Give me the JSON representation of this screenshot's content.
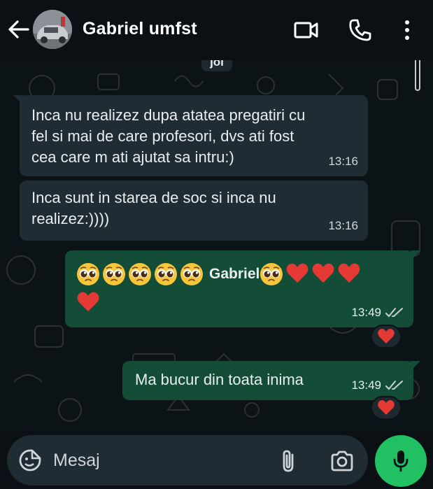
{
  "header": {
    "contact_name": "Gabriel umfst",
    "icons": [
      "back-arrow-icon",
      "video-call-icon",
      "voice-call-icon",
      "more-options-icon"
    ]
  },
  "chat": {
    "date_chip": "joi",
    "messages": [
      {
        "direction": "incoming",
        "lines": [
          "Inca nu realizez dupa atatea pregatiri cu",
          "fel si mai de care profesori, dvs ati fost",
          "cea care m ati ajutat sa intru:)"
        ],
        "time": "13:16"
      },
      {
        "direction": "incoming",
        "lines": [
          "Inca sunt in starea de soc si inca nu",
          "realizez:))))"
        ],
        "time": "13:16"
      },
      {
        "direction": "outgoing",
        "text_name": "Gabriel",
        "emoji_before": "pleading-face x5",
        "emoji_after": "pleading-face, red-heart x4",
        "time": "13:49",
        "status": "read",
        "reaction": "❤️"
      },
      {
        "direction": "outgoing",
        "text": "Ma bucur din toata inima",
        "time": "13:49",
        "status": "read",
        "reaction": "❤️"
      }
    ]
  },
  "composer": {
    "placeholder": "Mesaj"
  },
  "colors": {
    "background": "#0b1014",
    "incoming_bubble": "#202c33",
    "outgoing_bubble": "#144d37",
    "mic_button": "#21c063"
  }
}
